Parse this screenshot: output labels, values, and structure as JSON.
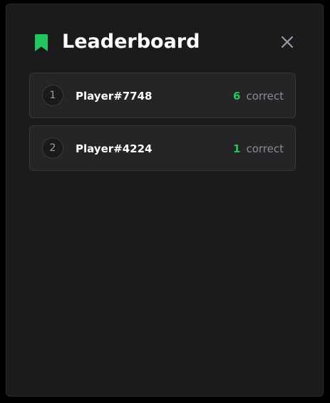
{
  "panel": {
    "title": "Leaderboard",
    "icons": {
      "title_icon": "bookmark-icon",
      "close_icon": "close-icon"
    },
    "colors": {
      "accent": "#22c55e",
      "background": "#1b1b1d",
      "card": "#252528"
    }
  },
  "leaderboard": {
    "entries": [
      {
        "rank": "1",
        "name": "Player#7748",
        "score": "6",
        "unit": "correct"
      },
      {
        "rank": "2",
        "name": "Player#4224",
        "score": "1",
        "unit": "correct"
      }
    ]
  }
}
